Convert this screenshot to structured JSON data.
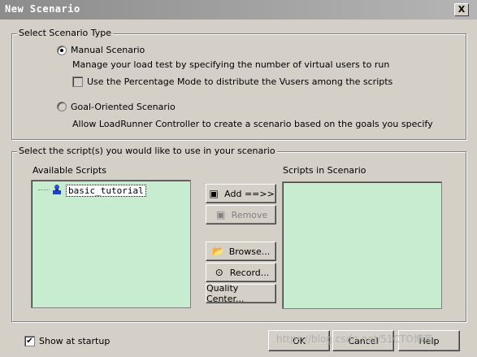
{
  "window": {
    "title": "New Scenario",
    "close_label": "X"
  },
  "scenario_type": {
    "legend": "Select Scenario Type",
    "manual": {
      "label": "Manual Scenario",
      "description": "Manage your load test by specifying the number of virtual users to run",
      "checked": true
    },
    "percentage_mode": {
      "label": "Use the Percentage Mode to distribute the Vusers among the scripts",
      "checked": false
    },
    "goal": {
      "label": "Goal-Oriented Scenario",
      "description": "Allow LoadRunner Controller to create a scenario based on the goals you specify",
      "checked": false
    }
  },
  "scripts": {
    "legend": "Select the script(s) you would like to use in your scenario",
    "available_label": "Available Scripts",
    "in_scenario_label": "Scripts in Scenario",
    "available_items": [
      "basic_tutorial"
    ],
    "buttons": {
      "add": "Add ==>>",
      "remove": "Remove",
      "browse": "Browse...",
      "record": "Record...",
      "quality_center": "Quality Center..."
    }
  },
  "footer": {
    "show_at_startup": {
      "label": "Show at startup",
      "checked": true
    },
    "ok": "OK",
    "cancel": "Cancel",
    "help": "Help"
  },
  "watermark": "https://blog.csdn.net/51CTO博客",
  "colors": {
    "list_background": "#c8ecd0",
    "dialog": "#d4d0c8"
  }
}
